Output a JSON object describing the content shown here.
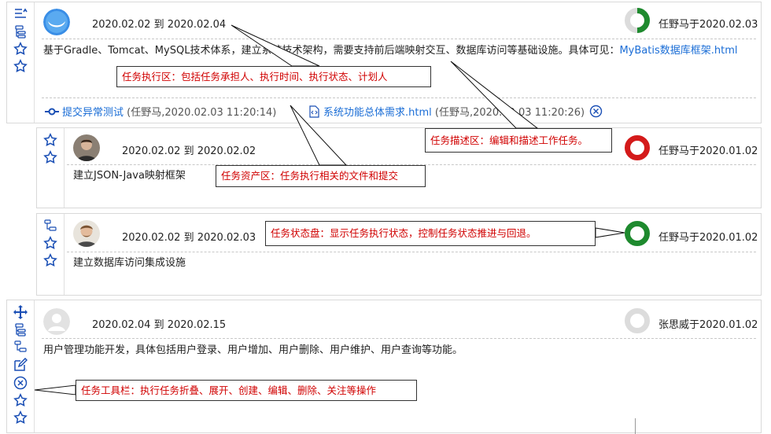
{
  "tasks": [
    {
      "dates_from": "2020.02.02",
      "dates_to": "2020.02.04",
      "dates_sep": "到",
      "meta": "任野马于2020.02.03",
      "desc_text": "基于Gradle、Tomcat、MySQL技术体系，建立系统技术架构，需要支持前后端映射交互、数据库访问等基础设施。具体可见：",
      "desc_link": "MyBatis数据库框架.html",
      "assets": [
        {
          "label": "提交异常测试",
          "info": "(任野马,2020.02.03 11:20:14)"
        },
        {
          "label": "系统功能总体需求.html",
          "info": "(任野马,2020.02.03 11:20:26)"
        }
      ]
    },
    {
      "dates_from": "2020.02.02",
      "dates_to": "2020.02.02",
      "dates_sep": "到",
      "meta": "任野马于2020.01.02",
      "desc_text": "建立JSON-Java映射框架"
    },
    {
      "dates_from": "2020.02.02",
      "dates_to": "2020.02.03",
      "dates_sep": "到",
      "meta": "任野马于2020.01.02",
      "desc_text": "建立数据库访问集成设施"
    },
    {
      "dates_from": "2020.02.04",
      "dates_to": "2020.02.15",
      "dates_sep": "到",
      "meta": "张思威于2020.01.02",
      "desc_text": "用户管理功能开发，具体包括用户登录、用户增加、用户删除、用户维护、用户查询等功能。"
    }
  ],
  "callouts": {
    "exec": "任务执行区：包括任务承担人、执行时间、执行状态、计划人",
    "desc": "任务描述区：编辑和描述工作任务。",
    "assets": "任务资产区：任务执行相关的文件和提交",
    "status": "任务状态盘：显示任务执行状态，控制任务状态推进与回退。",
    "toolbar": "任务工具栏：执行任务折叠、展开、创建、编辑、删除、关注等操作"
  },
  "colors": {
    "accent": "#1a6dd6",
    "status_green": "#1e8a2e",
    "status_red": "#d41a1a",
    "status_empty": "#dcdcdc",
    "callout_text": "#d00000"
  },
  "icons": {
    "collapse": "collapse-icon",
    "tree": "tree-icon",
    "star": "star-outline-icon",
    "move": "move-icon",
    "edit": "edit-icon",
    "delete": "close-circle-icon",
    "commit": "commit-icon",
    "file": "file-code-icon"
  }
}
